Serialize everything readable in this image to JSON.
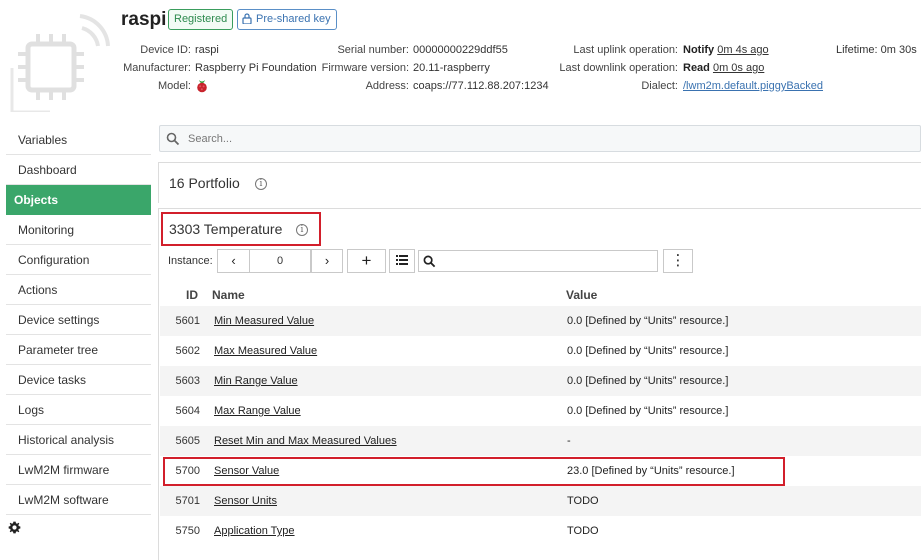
{
  "device": {
    "name": "raspi",
    "status_badge": "Registered",
    "security_badge": "Pre-shared key",
    "fields": {
      "device_id_label": "Device ID:",
      "device_id": "raspi",
      "manufacturer_label": "Manufacturer:",
      "manufacturer": "Raspberry Pi Foundation",
      "model_label": "Model:",
      "serial_label": "Serial number:",
      "serial": "00000000229ddf55",
      "firmware_label": "Firmware version:",
      "firmware": "20.11-raspberry",
      "address_label": "Address:",
      "address": "coaps://77.112.88.207:1234",
      "uplink_label": "Last uplink operation:",
      "uplink_op": "Notify",
      "uplink_time": "0m 4s ago",
      "downlink_label": "Last downlink operation:",
      "downlink_op": "Read",
      "downlink_time": "0m 0s ago",
      "dialect_label": "Dialect:",
      "dialect": "/lwm2m.default.piggyBacked",
      "lifetime_label": "Lifetime:",
      "lifetime": "0m 30s"
    }
  },
  "sidebar": {
    "items": [
      {
        "label": "Variables"
      },
      {
        "label": "Dashboard"
      },
      {
        "label": "Objects"
      },
      {
        "label": "Monitoring"
      },
      {
        "label": "Configuration"
      },
      {
        "label": "Actions"
      },
      {
        "label": "Device settings"
      },
      {
        "label": "Parameter tree"
      },
      {
        "label": "Device tasks"
      },
      {
        "label": "Logs"
      },
      {
        "label": "Historical analysis"
      },
      {
        "label": "LwM2M firmware"
      },
      {
        "label": "LwM2M software"
      }
    ],
    "active": "Objects"
  },
  "search": {
    "placeholder": "Search..."
  },
  "objects": [
    {
      "title": "16 Portfolio"
    },
    {
      "title": "3303 Temperature"
    }
  ],
  "instance": {
    "label": "Instance:",
    "value": "0",
    "prev": "‹",
    "next": "›",
    "add": "+",
    "more": "⋮"
  },
  "table": {
    "headers": {
      "id": "ID",
      "name": "Name",
      "value": "Value"
    },
    "rows": [
      {
        "id": "5601",
        "name": "Min Measured Value",
        "value": "0.0 [Defined by “Units” resource.]"
      },
      {
        "id": "5602",
        "name": "Max Measured Value",
        "value": "0.0 [Defined by “Units” resource.]"
      },
      {
        "id": "5603",
        "name": "Min Range Value",
        "value": "0.0 [Defined by “Units” resource.]"
      },
      {
        "id": "5604",
        "name": "Max Range Value",
        "value": "0.0 [Defined by “Units” resource.]"
      },
      {
        "id": "5605",
        "name": "Reset Min and Max Measured Values",
        "value": "-"
      },
      {
        "id": "5700",
        "name": "Sensor Value",
        "value": "23.0 [Defined by “Units” resource.]"
      },
      {
        "id": "5701",
        "name": "Sensor Units",
        "value": "TODO"
      },
      {
        "id": "5750",
        "name": "Application Type",
        "value": "TODO"
      }
    ]
  },
  "colors": {
    "accent": "#3aa66a",
    "highlight": "#d21f2b",
    "link": "#3a72b0"
  }
}
